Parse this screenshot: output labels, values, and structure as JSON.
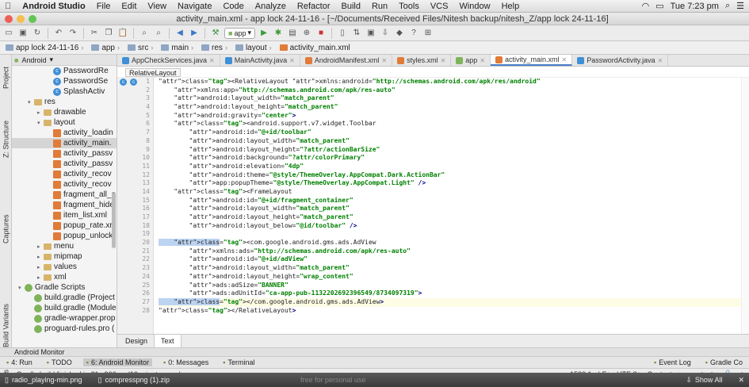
{
  "menubar": {
    "app": "Android Studio",
    "items": [
      "File",
      "Edit",
      "View",
      "Navigate",
      "Code",
      "Analyze",
      "Refactor",
      "Build",
      "Run",
      "Tools",
      "VCS",
      "Window",
      "Help"
    ],
    "clock": "Tue 7:23 pm"
  },
  "window": {
    "title": "activity_main.xml - app lock 24-11-16 - [~/Documents/Received Files/Nitesh backup/nitesh_Z/app lock 24-11-16]"
  },
  "toolbar": {
    "run_config": "app"
  },
  "navbar": {
    "crumbs": [
      "app lock 24-11-16",
      "app",
      "src",
      "main",
      "res",
      "layout",
      "activity_main.xml"
    ]
  },
  "leftstrip": {
    "tabs": [
      "Project",
      "Z: Structure",
      "Captures",
      "Build Variants",
      "Favorites"
    ]
  },
  "project": {
    "view": "Android",
    "tree": [
      {
        "label": "PasswordRe",
        "icon": "class-icon",
        "indent": 4
      },
      {
        "label": "PasswordSe",
        "icon": "class-icon",
        "indent": 4
      },
      {
        "label": "SplashActiv",
        "icon": "class-icon",
        "indent": 4
      },
      {
        "label": "res",
        "icon": "folder-icon",
        "indent": 2,
        "toggle": "▾"
      },
      {
        "label": "drawable",
        "icon": "folder-icon",
        "indent": 3,
        "toggle": "▸"
      },
      {
        "label": "layout",
        "icon": "folder-icon",
        "indent": 3,
        "toggle": "▾"
      },
      {
        "label": "activity_loadin",
        "icon": "xml-icon",
        "indent": 4
      },
      {
        "label": "activity_main.",
        "icon": "xml-icon",
        "indent": 4,
        "selected": true
      },
      {
        "label": "activity_passv",
        "icon": "xml-icon",
        "indent": 4
      },
      {
        "label": "activity_passv",
        "icon": "xml-icon",
        "indent": 4
      },
      {
        "label": "activity_recov",
        "icon": "xml-icon",
        "indent": 4
      },
      {
        "label": "activity_recov",
        "icon": "xml-icon",
        "indent": 4
      },
      {
        "label": "fragment_all_a",
        "icon": "xml-icon",
        "indent": 4
      },
      {
        "label": "fragment_hide",
        "icon": "xml-icon",
        "indent": 4
      },
      {
        "label": "item_list.xml",
        "icon": "xml-icon",
        "indent": 4
      },
      {
        "label": "popup_rate.xr",
        "icon": "xml-icon",
        "indent": 4
      },
      {
        "label": "popup_unlock",
        "icon": "xml-icon",
        "indent": 4
      },
      {
        "label": "menu",
        "icon": "folder-icon",
        "indent": 3,
        "toggle": "▸"
      },
      {
        "label": "mipmap",
        "icon": "folder-icon",
        "indent": 3,
        "toggle": "▸"
      },
      {
        "label": "values",
        "icon": "folder-icon",
        "indent": 3,
        "toggle": "▸"
      },
      {
        "label": "xml",
        "icon": "folder-icon",
        "indent": 3,
        "toggle": "▸"
      },
      {
        "label": "Gradle Scripts",
        "icon": "gradle-icon",
        "indent": 1,
        "toggle": "▾"
      },
      {
        "label": "build.gradle (Project",
        "icon": "gradle-icon",
        "indent": 2
      },
      {
        "label": "build.gradle (Module",
        "icon": "gradle-icon",
        "indent": 2
      },
      {
        "label": "gradle-wrapper.prop",
        "icon": "gradle-icon",
        "indent": 2
      },
      {
        "label": "proguard-rules.pro (",
        "icon": "gradle-icon",
        "indent": 2
      }
    ]
  },
  "tabs": [
    {
      "label": "AppCheckServices.java",
      "color": "#3f8fd6"
    },
    {
      "label": "MainActivity.java",
      "color": "#3f8fd6"
    },
    {
      "label": "AndroidManifest.xml",
      "color": "#e07b39"
    },
    {
      "label": "styles.xml",
      "color": "#e07b39"
    },
    {
      "label": "app",
      "color": "#7fb35a"
    },
    {
      "label": "activity_main.xml",
      "color": "#e07b39",
      "active": true
    },
    {
      "label": "PasswordActivity.java",
      "color": "#3f8fd6"
    }
  ],
  "editor": {
    "breadcrumb": "RelativeLayout",
    "lines": [
      "<RelativeLayout xmlns:android=\"http://schemas.android.com/apk/res/android\"",
      "    xmlns:app=\"http://schemas.android.com/apk/res-auto\"",
      "    android:layout_width=\"match_parent\"",
      "    android:layout_height=\"match_parent\"",
      "    android:gravity=\"center\">",
      "    <android.support.v7.widget.Toolbar",
      "        android:id=\"@+id/toolbar\"",
      "        android:layout_width=\"match_parent\"",
      "        android:layout_height=\"?attr/actionBarSize\"",
      "        android:background=\"?attr/colorPrimary\"",
      "        android:elevation=\"4dp\"",
      "        android:theme=\"@style/ThemeOverlay.AppCompat.Dark.ActionBar\"",
      "        app:popupTheme=\"@style/ThemeOverlay.AppCompat.Light\" />",
      "    <FrameLayout",
      "        android:id=\"@+id/fragment_container\"",
      "        android:layout_width=\"match_parent\"",
      "        android:layout_height=\"match_parent\"",
      "        android:layout_below=\"@id/toolbar\" />",
      "",
      "    <com.google.android.gms.ads.AdView",
      "        xmlns:ads=\"http://schemas.android.com/apk/res-auto\"",
      "        android:id=\"@+id/adView\"",
      "        android:layout_width=\"match_parent\"",
      "        android:layout_height=\"wrap_content\"",
      "        ads:adSize=\"BANNER\"",
      "        ads:adUnitId=\"ca-app-pub-1132202692396549/8734097319\">",
      "    </com.google.android.gms.ads.AdView>",
      "</RelativeLayout>"
    ],
    "design_tabs": [
      "Design",
      "Text"
    ],
    "active_design_tab": "Text"
  },
  "monitor_label": "Android Monitor",
  "bottom_tabs": [
    {
      "label": "4: Run"
    },
    {
      "label": "TODO"
    },
    {
      "label": "6: Android Monitor",
      "active": true
    },
    {
      "label": "0: Messages"
    },
    {
      "label": "Terminal"
    }
  ],
  "bottom_right_tabs": [
    "Event Log",
    "Gradle Co"
  ],
  "status": {
    "message": "Gradle build finished in 21s 966ms (19 minutes ago)",
    "position": "1539:1",
    "line_sep": "LF÷",
    "encoding": "UTF-8÷",
    "context": "Context: <no context>"
  },
  "dock": {
    "items": [
      "radio_playing-min.png",
      "compresspng (1).zip",
      "free for personal use"
    ],
    "show_all": "Show All"
  }
}
